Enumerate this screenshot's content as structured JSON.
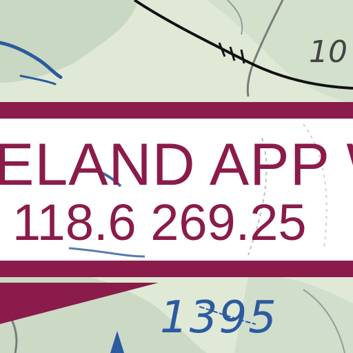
{
  "map": {
    "frequency_box": {
      "facility_name": "ELAND APP W",
      "frequencies": "118.6 269.25"
    },
    "elevation_figure": "1395",
    "partial_number": "10",
    "colors": {
      "terrain": "#dfe9d6",
      "terrain_shade": "#c9d8c2",
      "magenta": "#8a1b4a",
      "water": "#2c5aa0",
      "road": "#111111",
      "contour": "#7b7b7b"
    },
    "symbols": [
      "railroad-line",
      "water-stream",
      "obstruction-marker",
      "contour-line"
    ]
  }
}
